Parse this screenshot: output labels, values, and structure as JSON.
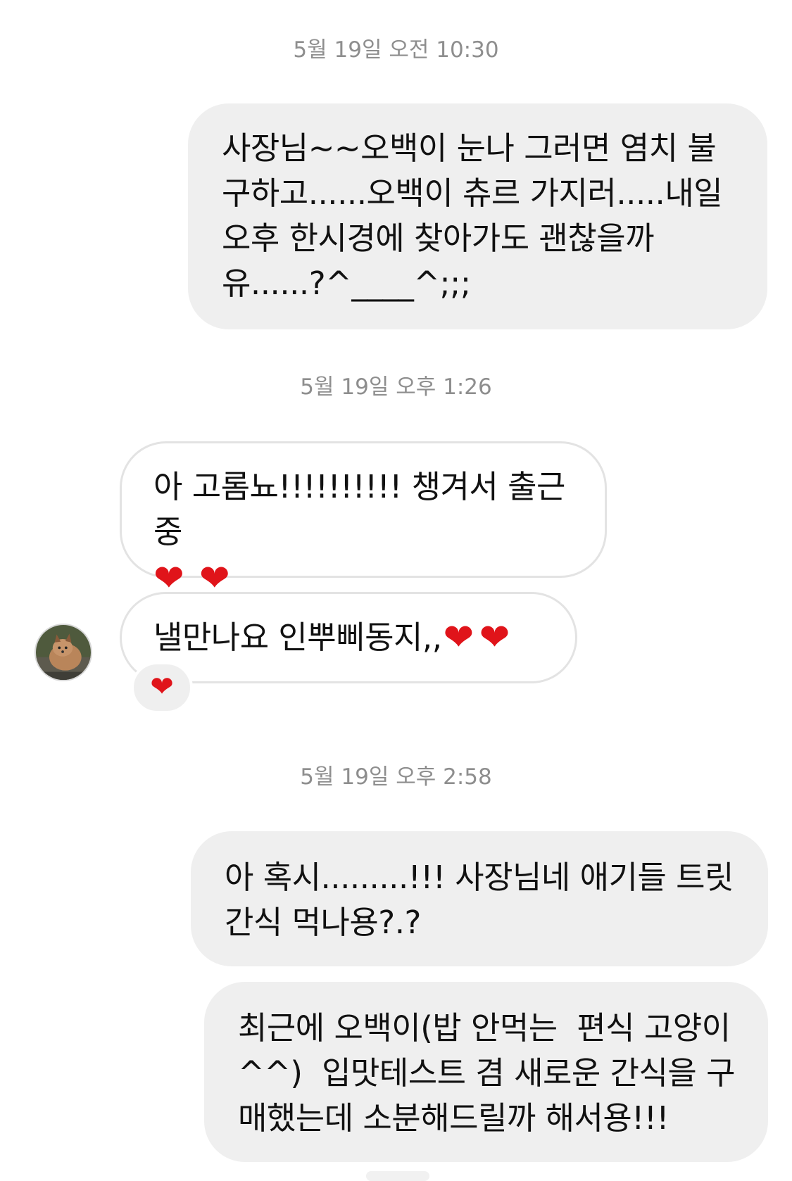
{
  "timestamps": [
    "5월 19일 오전 10:30",
    "5월 19일 오후 1:26",
    "5월 19일 오후 2:58"
  ],
  "messages": [
    {
      "from": "me",
      "lines": [
        "사장님~~오백이 눈나 그러면 염치 불",
        "구하고......오백이 츄르 가지러.....내일",
        "오후 한시경에 찾아가도 괜찮을까",
        "유......?^____^;;;"
      ]
    },
    {
      "from": "other",
      "lines": [
        "아 고롬뇨!!!!!!!!!! 챙겨서 출근중"
      ],
      "hearts": [
        "❤",
        "❤"
      ]
    },
    {
      "from": "other",
      "text": "낼만나요 인뿌삐동지,,",
      "hearts": [
        "❤",
        "❤"
      ],
      "reaction": "❤"
    },
    {
      "from": "me",
      "lines": [
        "아 혹시.........!!! 사장님네 애기들 트릿",
        "간식 먹나용?.?"
      ]
    },
    {
      "from": "me",
      "lines": [
        "최근에 오백이(밥 안먹는  편식 고양이",
        "^^)  입맛테스트 겸 새로운 간식을 구",
        "매했는데 소분해드릴까 해서용!!!"
      ]
    }
  ],
  "colors": {
    "sent_bubble": "#efefef",
    "received_border": "#e3e3e3",
    "timestamp": "#8e8e8e",
    "heart": "#e0141a"
  },
  "icons": {
    "heart": "heart-icon",
    "avatar": "fox-cub-avatar"
  }
}
